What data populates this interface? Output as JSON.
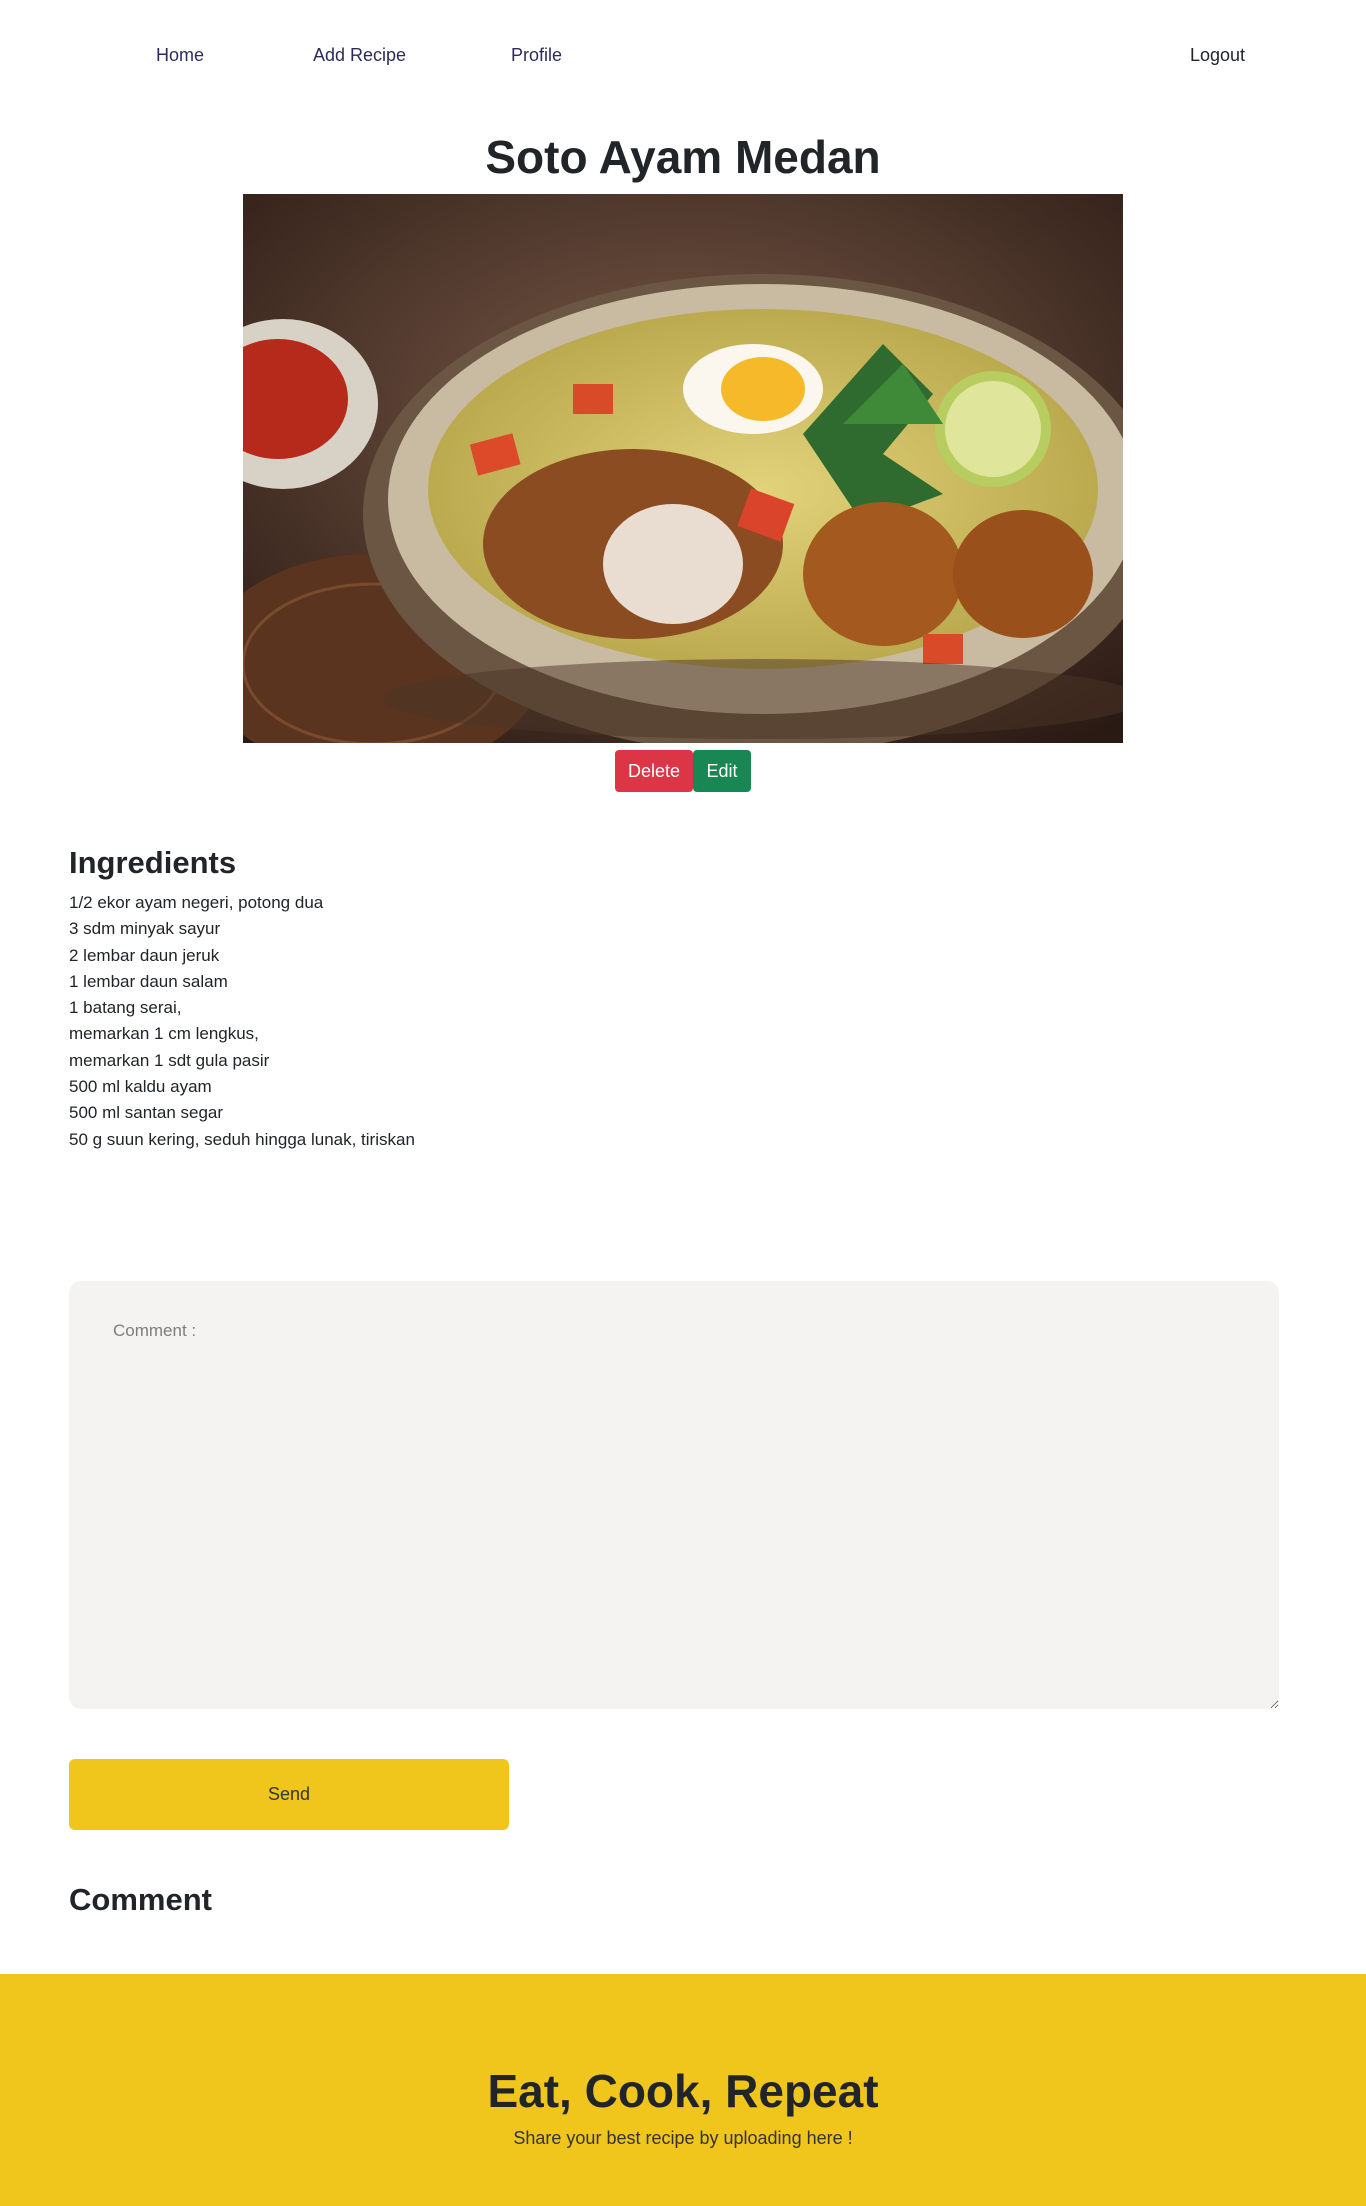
{
  "nav": {
    "home": "Home",
    "add_recipe": "Add Recipe",
    "profile": "Profile",
    "logout": "Logout"
  },
  "recipe": {
    "title": "Soto Ayam Medan",
    "delete_label": "Delete",
    "edit_label": "Edit"
  },
  "ingredients": {
    "heading": "Ingredients",
    "items": [
      "1/2 ekor ayam negeri, potong dua",
      "3 sdm minyak sayur",
      "2 lembar daun jeruk",
      "1 lembar daun salam",
      "1 batang serai,",
      "memarkan 1 cm lengkus,",
      "memarkan 1 sdt gula pasir",
      "500 ml kaldu ayam",
      "500 ml santan segar",
      "50 g suun kering, seduh hingga lunak, tiriskan"
    ]
  },
  "comment_form": {
    "placeholder": "Comment :",
    "value": "",
    "send_label": "Send"
  },
  "comments": {
    "heading": "Comment"
  },
  "footer": {
    "title": "Eat, Cook, Repeat",
    "subtitle": "Share your best recipe by uploading here !"
  },
  "colors": {
    "accent": "#f0c61c",
    "danger": "#dc3545",
    "success": "#198754",
    "nav_link": "#2e2a5c"
  }
}
